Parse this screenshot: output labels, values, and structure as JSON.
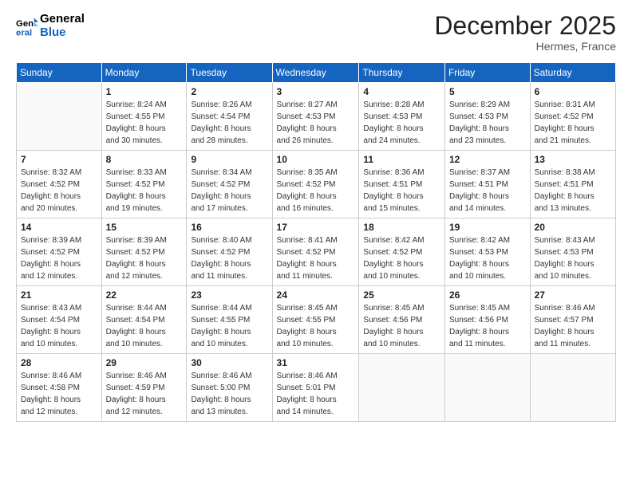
{
  "header": {
    "logo_line1": "General",
    "logo_line2": "Blue",
    "month": "December 2025",
    "location": "Hermes, France"
  },
  "days_of_week": [
    "Sunday",
    "Monday",
    "Tuesday",
    "Wednesday",
    "Thursday",
    "Friday",
    "Saturday"
  ],
  "weeks": [
    [
      {
        "day": "",
        "info": ""
      },
      {
        "day": "1",
        "info": "Sunrise: 8:24 AM\nSunset: 4:55 PM\nDaylight: 8 hours\nand 30 minutes."
      },
      {
        "day": "2",
        "info": "Sunrise: 8:26 AM\nSunset: 4:54 PM\nDaylight: 8 hours\nand 28 minutes."
      },
      {
        "day": "3",
        "info": "Sunrise: 8:27 AM\nSunset: 4:53 PM\nDaylight: 8 hours\nand 26 minutes."
      },
      {
        "day": "4",
        "info": "Sunrise: 8:28 AM\nSunset: 4:53 PM\nDaylight: 8 hours\nand 24 minutes."
      },
      {
        "day": "5",
        "info": "Sunrise: 8:29 AM\nSunset: 4:53 PM\nDaylight: 8 hours\nand 23 minutes."
      },
      {
        "day": "6",
        "info": "Sunrise: 8:31 AM\nSunset: 4:52 PM\nDaylight: 8 hours\nand 21 minutes."
      }
    ],
    [
      {
        "day": "7",
        "info": "Sunrise: 8:32 AM\nSunset: 4:52 PM\nDaylight: 8 hours\nand 20 minutes."
      },
      {
        "day": "8",
        "info": "Sunrise: 8:33 AM\nSunset: 4:52 PM\nDaylight: 8 hours\nand 19 minutes."
      },
      {
        "day": "9",
        "info": "Sunrise: 8:34 AM\nSunset: 4:52 PM\nDaylight: 8 hours\nand 17 minutes."
      },
      {
        "day": "10",
        "info": "Sunrise: 8:35 AM\nSunset: 4:52 PM\nDaylight: 8 hours\nand 16 minutes."
      },
      {
        "day": "11",
        "info": "Sunrise: 8:36 AM\nSunset: 4:51 PM\nDaylight: 8 hours\nand 15 minutes."
      },
      {
        "day": "12",
        "info": "Sunrise: 8:37 AM\nSunset: 4:51 PM\nDaylight: 8 hours\nand 14 minutes."
      },
      {
        "day": "13",
        "info": "Sunrise: 8:38 AM\nSunset: 4:51 PM\nDaylight: 8 hours\nand 13 minutes."
      }
    ],
    [
      {
        "day": "14",
        "info": "Sunrise: 8:39 AM\nSunset: 4:52 PM\nDaylight: 8 hours\nand 12 minutes."
      },
      {
        "day": "15",
        "info": "Sunrise: 8:39 AM\nSunset: 4:52 PM\nDaylight: 8 hours\nand 12 minutes."
      },
      {
        "day": "16",
        "info": "Sunrise: 8:40 AM\nSunset: 4:52 PM\nDaylight: 8 hours\nand 11 minutes."
      },
      {
        "day": "17",
        "info": "Sunrise: 8:41 AM\nSunset: 4:52 PM\nDaylight: 8 hours\nand 11 minutes."
      },
      {
        "day": "18",
        "info": "Sunrise: 8:42 AM\nSunset: 4:52 PM\nDaylight: 8 hours\nand 10 minutes."
      },
      {
        "day": "19",
        "info": "Sunrise: 8:42 AM\nSunset: 4:53 PM\nDaylight: 8 hours\nand 10 minutes."
      },
      {
        "day": "20",
        "info": "Sunrise: 8:43 AM\nSunset: 4:53 PM\nDaylight: 8 hours\nand 10 minutes."
      }
    ],
    [
      {
        "day": "21",
        "info": "Sunrise: 8:43 AM\nSunset: 4:54 PM\nDaylight: 8 hours\nand 10 minutes."
      },
      {
        "day": "22",
        "info": "Sunrise: 8:44 AM\nSunset: 4:54 PM\nDaylight: 8 hours\nand 10 minutes."
      },
      {
        "day": "23",
        "info": "Sunrise: 8:44 AM\nSunset: 4:55 PM\nDaylight: 8 hours\nand 10 minutes."
      },
      {
        "day": "24",
        "info": "Sunrise: 8:45 AM\nSunset: 4:55 PM\nDaylight: 8 hours\nand 10 minutes."
      },
      {
        "day": "25",
        "info": "Sunrise: 8:45 AM\nSunset: 4:56 PM\nDaylight: 8 hours\nand 10 minutes."
      },
      {
        "day": "26",
        "info": "Sunrise: 8:45 AM\nSunset: 4:56 PM\nDaylight: 8 hours\nand 11 minutes."
      },
      {
        "day": "27",
        "info": "Sunrise: 8:46 AM\nSunset: 4:57 PM\nDaylight: 8 hours\nand 11 minutes."
      }
    ],
    [
      {
        "day": "28",
        "info": "Sunrise: 8:46 AM\nSunset: 4:58 PM\nDaylight: 8 hours\nand 12 minutes."
      },
      {
        "day": "29",
        "info": "Sunrise: 8:46 AM\nSunset: 4:59 PM\nDaylight: 8 hours\nand 12 minutes."
      },
      {
        "day": "30",
        "info": "Sunrise: 8:46 AM\nSunset: 5:00 PM\nDaylight: 8 hours\nand 13 minutes."
      },
      {
        "day": "31",
        "info": "Sunrise: 8:46 AM\nSunset: 5:01 PM\nDaylight: 8 hours\nand 14 minutes."
      },
      {
        "day": "",
        "info": ""
      },
      {
        "day": "",
        "info": ""
      },
      {
        "day": "",
        "info": ""
      }
    ]
  ]
}
